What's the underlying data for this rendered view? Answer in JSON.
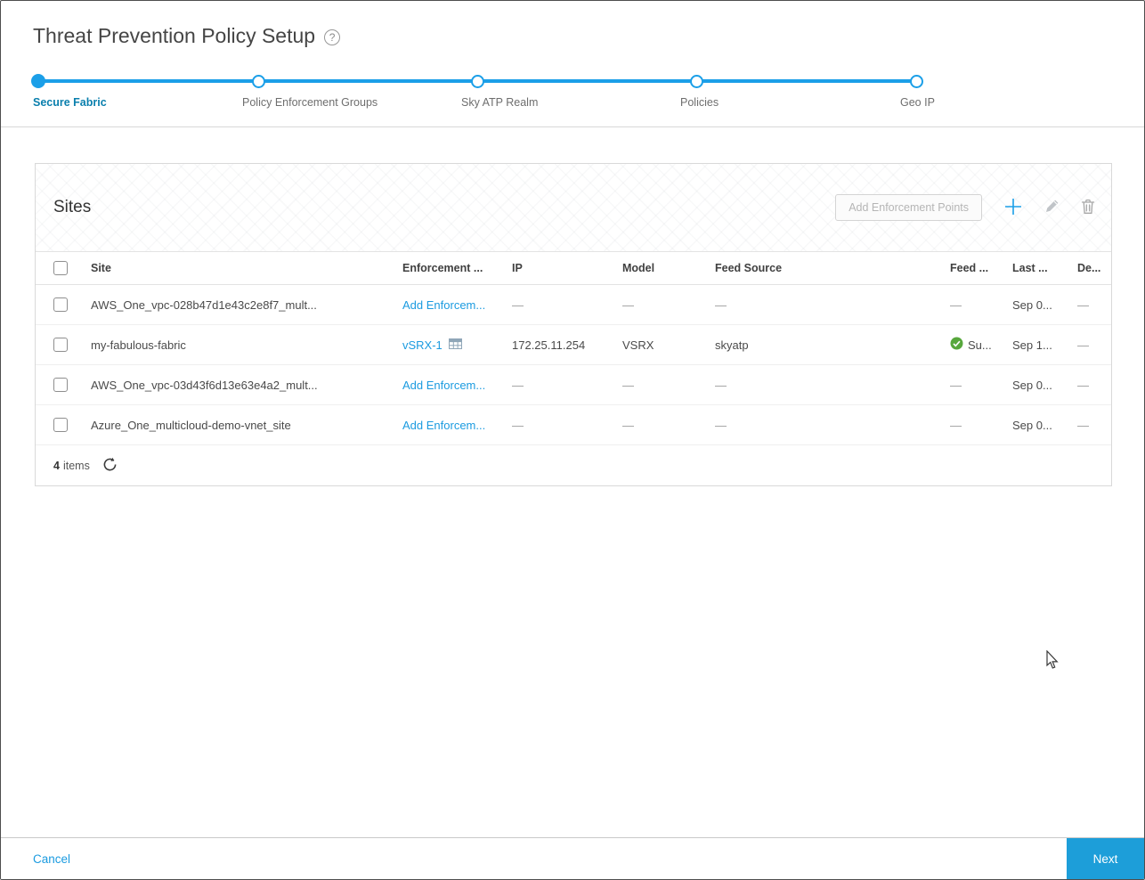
{
  "page": {
    "title": "Threat Prevention Policy Setup",
    "help_glyph": "?"
  },
  "stepper": {
    "steps": [
      {
        "label": "Secure Fabric",
        "state": "active"
      },
      {
        "label": "Policy Enforcement Groups",
        "state": "upcoming"
      },
      {
        "label": "Sky ATP Realm",
        "state": "upcoming"
      },
      {
        "label": "Policies",
        "state": "upcoming"
      },
      {
        "label": "Geo IP",
        "state": "upcoming"
      }
    ]
  },
  "sites_panel": {
    "title": "Sites",
    "toolbar": {
      "add_enforcement_points_label": "Add Enforcement Points",
      "icons": [
        "plus-icon",
        "edit-icon",
        "delete-icon"
      ]
    },
    "table": {
      "columns": [
        "Site",
        "Enforcement ...",
        "IP",
        "Model",
        "Feed Source",
        "Feed ...",
        "Last ...",
        "De..."
      ],
      "rows": [
        {
          "site": "AWS_One_vpc-028b47d1e43c2e8f7_mult...",
          "enforcement": "Add Enforcem...",
          "ip": "—",
          "model": "—",
          "feed_source": "—",
          "feed_status": "—",
          "last_updated": "Sep 0...",
          "description": "—"
        },
        {
          "site": "my-fabulous-fabric",
          "enforcement": "vSRX-1",
          "ip": "172.25.11.254",
          "model": "VSRX",
          "feed_source": "skyatp",
          "feed_status": "Su...",
          "last_updated": "Sep 1...",
          "description": "—"
        },
        {
          "site": "AWS_One_vpc-03d43f6d13e63e4a2_mult...",
          "enforcement": "Add Enforcem...",
          "ip": "—",
          "model": "—",
          "feed_source": "—",
          "feed_status": "—",
          "last_updated": "Sep 0...",
          "description": "—"
        },
        {
          "site": "Azure_One_multicloud-demo-vnet_site",
          "enforcement": "Add Enforcem...",
          "ip": "—",
          "model": "—",
          "feed_source": "—",
          "feed_status": "—",
          "last_updated": "Sep 0...",
          "description": "—"
        }
      ],
      "footer": {
        "count": "4",
        "items_label": "items"
      }
    }
  },
  "bottom_bar": {
    "cancel_label": "Cancel",
    "next_label": "Next"
  },
  "colors": {
    "accent_blue": "#1b9fe8",
    "link_blue": "#1b9be0",
    "active_step_blue": "#0a7fad",
    "success_green": "#57a73c",
    "next_button_blue": "#1d9ed9"
  }
}
